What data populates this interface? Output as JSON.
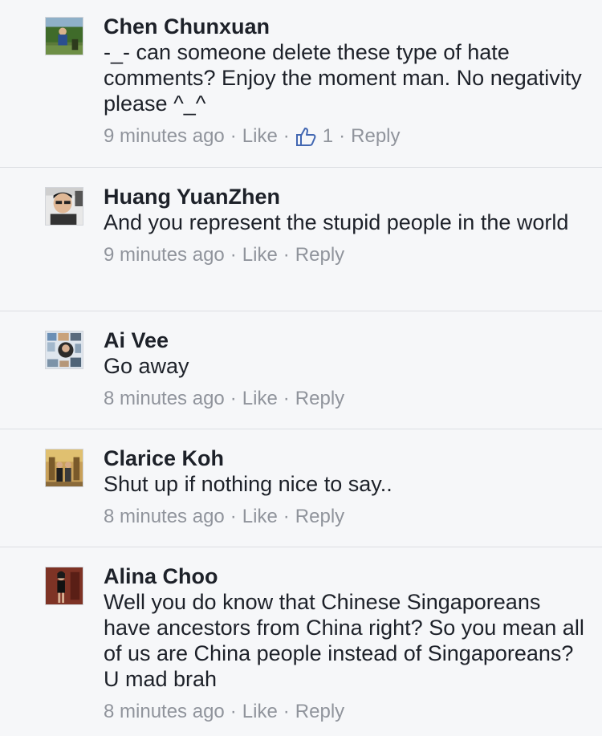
{
  "comments": [
    {
      "author": "Chen Chunxuan",
      "text": "-_- can someone delete these type of hate comments? Enjoy the moment man. No negativity please ^_^",
      "time": "9 minutes ago",
      "like_label": "Like",
      "like_count": "1",
      "reply_label": "Reply",
      "avatar_icon": "profile-photo-outdoor"
    },
    {
      "author": "Huang YuanZhen",
      "text": "And you represent the stupid people in the world",
      "time": "9 minutes ago",
      "like_label": "Like",
      "reply_label": "Reply",
      "avatar_icon": "profile-photo-portrait"
    },
    {
      "author": "Ai Vee",
      "text": "Go away",
      "time": "8 minutes ago",
      "like_label": "Like",
      "reply_label": "Reply",
      "avatar_icon": "profile-photo-collage"
    },
    {
      "author": "Clarice Koh",
      "text": "Shut up if nothing nice to say..",
      "time": "8 minutes ago",
      "like_label": "Like",
      "reply_label": "Reply",
      "avatar_icon": "profile-photo-group"
    },
    {
      "author": "Alina Choo",
      "text": "Well you do know that Chinese Singaporeans have ancestors from China right? So you mean all of us are China people instead of Singaporeans? U mad brah",
      "time": "8 minutes ago",
      "like_label": "Like",
      "reply_label": "Reply",
      "avatar_icon": "profile-photo-standing"
    }
  ],
  "separator": "·",
  "colors": {
    "background": "#f6f7f9",
    "name": "#1d2129",
    "meta": "#90949c",
    "like_icon": "#4267b2",
    "divider": "#dcdee3"
  }
}
